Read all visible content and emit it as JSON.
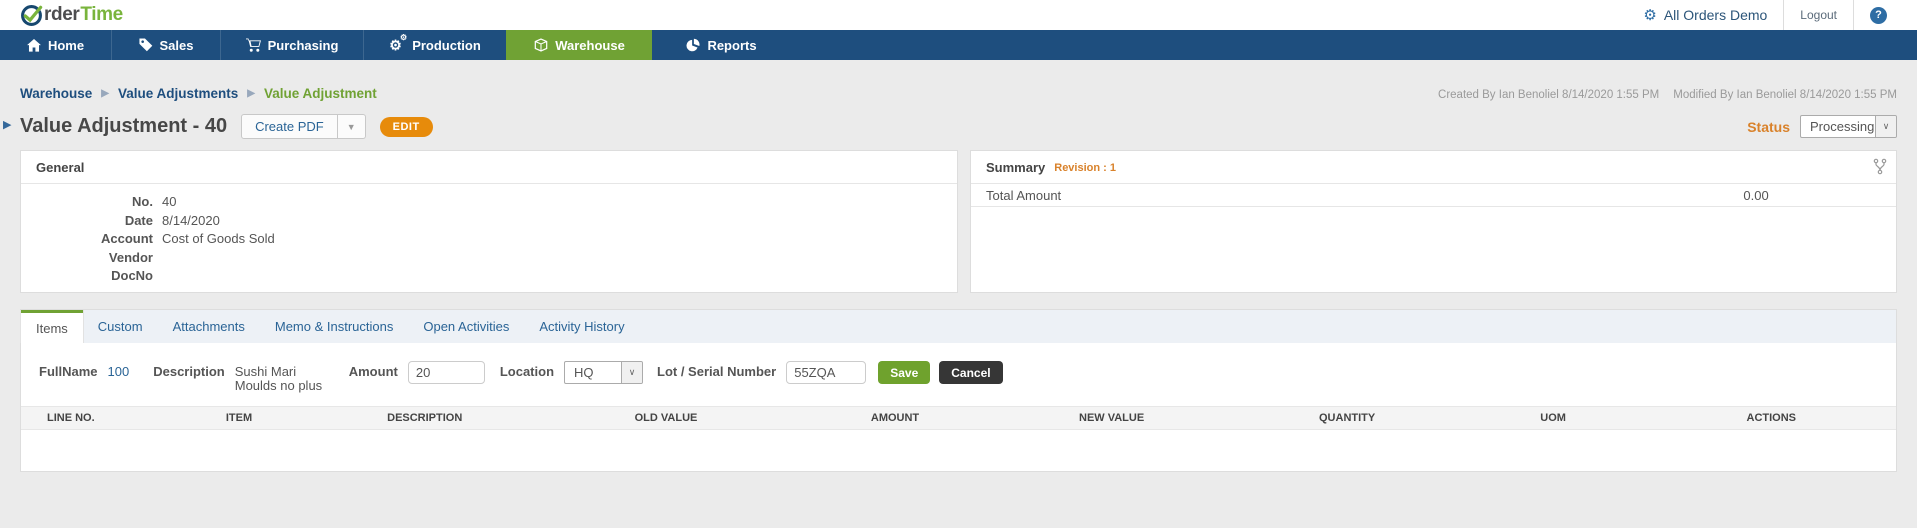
{
  "topbar": {
    "logo_part1": "rder",
    "logo_part2": "Time",
    "account_label": "All Orders Demo",
    "logout_label": "Logout",
    "help_label": "?"
  },
  "nav": {
    "items": [
      {
        "label": "Home",
        "icon": "home-icon",
        "active": false
      },
      {
        "label": "Sales",
        "icon": "tags-icon",
        "active": false
      },
      {
        "label": "Purchasing",
        "icon": "cart-icon",
        "active": false
      },
      {
        "label": "Production",
        "icon": "gears-icon",
        "active": false
      },
      {
        "label": "Warehouse",
        "icon": "box-icon",
        "active": true
      },
      {
        "label": "Reports",
        "icon": "pie-chart-icon",
        "active": false
      }
    ]
  },
  "breadcrumb": {
    "items": [
      {
        "label": "Warehouse"
      },
      {
        "label": "Value Adjustments"
      },
      {
        "label": "Value Adjustment"
      }
    ]
  },
  "meta": {
    "created": "Created By Ian Benoliel 8/14/2020 1:55 PM",
    "modified": "Modified By Ian Benoliel 8/14/2020 1:55 PM"
  },
  "header": {
    "title": "Value Adjustment - 40",
    "create_pdf_label": "Create PDF",
    "edit_label": "EDIT",
    "status_label": "Status",
    "status_value": "Processing"
  },
  "general": {
    "title": "General",
    "rows": [
      {
        "label": "No.",
        "value": "40"
      },
      {
        "label": "Date",
        "value": "8/14/2020"
      },
      {
        "label": "Account",
        "value": "Cost of Goods Sold"
      },
      {
        "label": "Vendor",
        "value": ""
      },
      {
        "label": "DocNo",
        "value": ""
      }
    ]
  },
  "summary": {
    "title": "Summary",
    "revision": "Revision : 1",
    "total_label": "Total Amount",
    "total_value": "0.00"
  },
  "tabs": {
    "items": [
      {
        "label": "Items",
        "active": true
      },
      {
        "label": "Custom",
        "active": false
      },
      {
        "label": "Attachments",
        "active": false
      },
      {
        "label": "Memo & Instructions",
        "active": false
      },
      {
        "label": "Open Activities",
        "active": false
      },
      {
        "label": "Activity History",
        "active": false
      }
    ]
  },
  "line_form": {
    "fullname_label": "FullName",
    "fullname_value": "100",
    "description_label": "Description",
    "description_value": "Sushi Mari Moulds no plus",
    "amount_label": "Amount",
    "amount_value": "20",
    "location_label": "Location",
    "location_value": "HQ",
    "lot_label": "Lot / Serial Number",
    "lot_value": "55ZQA",
    "save_label": "Save",
    "cancel_label": "Cancel"
  },
  "items_table": {
    "headers": [
      "LINE NO.",
      "ITEM",
      "DESCRIPTION",
      "OLD VALUE",
      "AMOUNT",
      "NEW VALUE",
      "QUANTITY",
      "UOM",
      "ACTIONS"
    ]
  },
  "colors": {
    "navy": "#1e4e7e",
    "green": "#70a234",
    "orange": "#e78b0b",
    "status_orange": "#d9822b",
    "link_blue": "#2a6496"
  }
}
